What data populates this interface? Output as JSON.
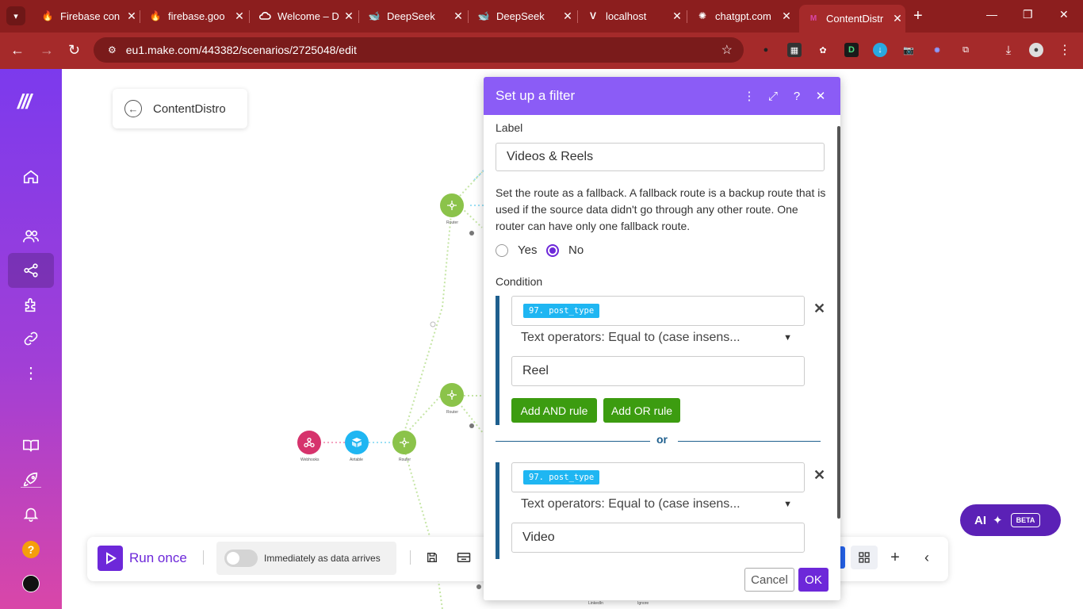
{
  "browser": {
    "tabs": [
      {
        "label": "Firebase con",
        "icon": "firebase-icon"
      },
      {
        "label": "firebase.goo",
        "icon": "firebase-icon"
      },
      {
        "label": "Welcome – D",
        "icon": "google-cloud-icon"
      },
      {
        "label": "DeepSeek",
        "icon": "deepseek-icon"
      },
      {
        "label": "DeepSeek",
        "icon": "deepseek-icon"
      },
      {
        "label": "localhost",
        "icon": "v-icon"
      },
      {
        "label": "chatgpt.com",
        "icon": "chatgpt-icon"
      },
      {
        "label": "ContentDistr",
        "icon": "make-icon"
      }
    ],
    "active_tab_index": 7,
    "url": "eu1.make.com/443382/scenarios/2725048/edit"
  },
  "scenario": {
    "back_label": "ContentDistro"
  },
  "canvas": {
    "modules": [
      {
        "label": "Webhooks",
        "color": "#d6336c"
      },
      {
        "label": "Airtable",
        "color": "#1fb6f2"
      },
      {
        "label": "Router",
        "color": "#8bc34a"
      },
      {
        "label": "Router",
        "color": "#8bc34a"
      },
      {
        "label": "Router",
        "color": "#8bc34a"
      }
    ],
    "bottom_labels": [
      "LinkedIn",
      "Ignore"
    ]
  },
  "toolbar": {
    "run_label": "Run once",
    "schedule_label": "Immediately as data arrives"
  },
  "ai_button": {
    "label": "AI",
    "badge": "BETA"
  },
  "modal": {
    "title": "Set up a filter",
    "label_caption": "Label",
    "label_value": "Videos & Reels",
    "fallback_text": "Set the route as a fallback. A fallback route is a backup route that is used if the source data didn't go through any other route. One router can have only one fallback route.",
    "yes_label": "Yes",
    "no_label": "No",
    "selected": "No",
    "condition_caption": "Condition",
    "groups": [
      {
        "field": "97. post_type",
        "operator": "Text operators: Equal to (case insens...",
        "value": "Reel"
      },
      {
        "field": "97. post_type",
        "operator": "Text operators: Equal to (case insens...",
        "value": "Video"
      }
    ],
    "add_and_label": "Add AND rule",
    "add_or_label": "Add OR rule",
    "or_label": "or",
    "cancel_label": "Cancel",
    "ok_label": "OK"
  },
  "colors": {
    "browser_frame": "#a52a2a",
    "modal_header": "#8b5cf6",
    "accent": "#6d28d9",
    "green_button": "#3c9c10",
    "rule_bar": "#1e5f8e",
    "field_pill": "#1fb6f2"
  }
}
